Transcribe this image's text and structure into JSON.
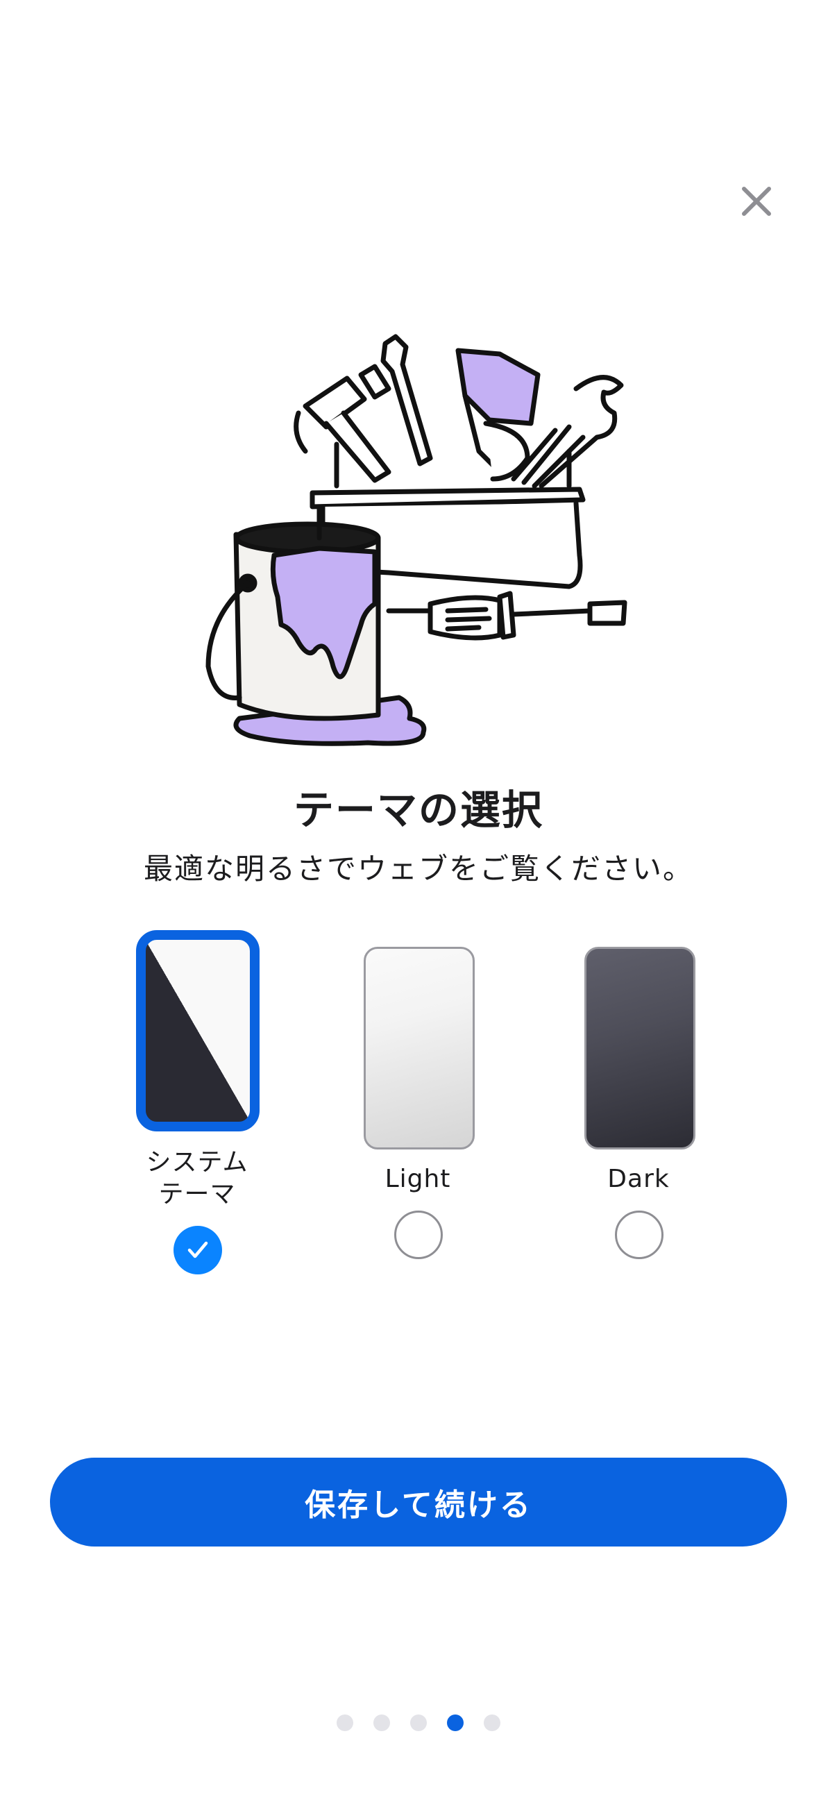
{
  "header": {
    "close_icon": "close-icon"
  },
  "illustration": {
    "icon": "toolbox-paint-bucket-illustration",
    "accent_color": "#c4b0f4"
  },
  "title": "テーマの選択",
  "subtitle": "最適な明るさでウェブをご覧ください。",
  "themes": [
    {
      "id": "system",
      "label_line1": "システム",
      "label_line2": "テーマ",
      "selected": true
    },
    {
      "id": "light",
      "label": "Light",
      "selected": false
    },
    {
      "id": "dark",
      "label": "Dark",
      "selected": false
    }
  ],
  "save_button": {
    "label": "保存して続ける"
  },
  "pagination": {
    "total": 5,
    "current": 4
  },
  "colors": {
    "primary": "#0a63e0",
    "check": "#0a84ff",
    "dot_inactive": "#e3e3e8"
  }
}
